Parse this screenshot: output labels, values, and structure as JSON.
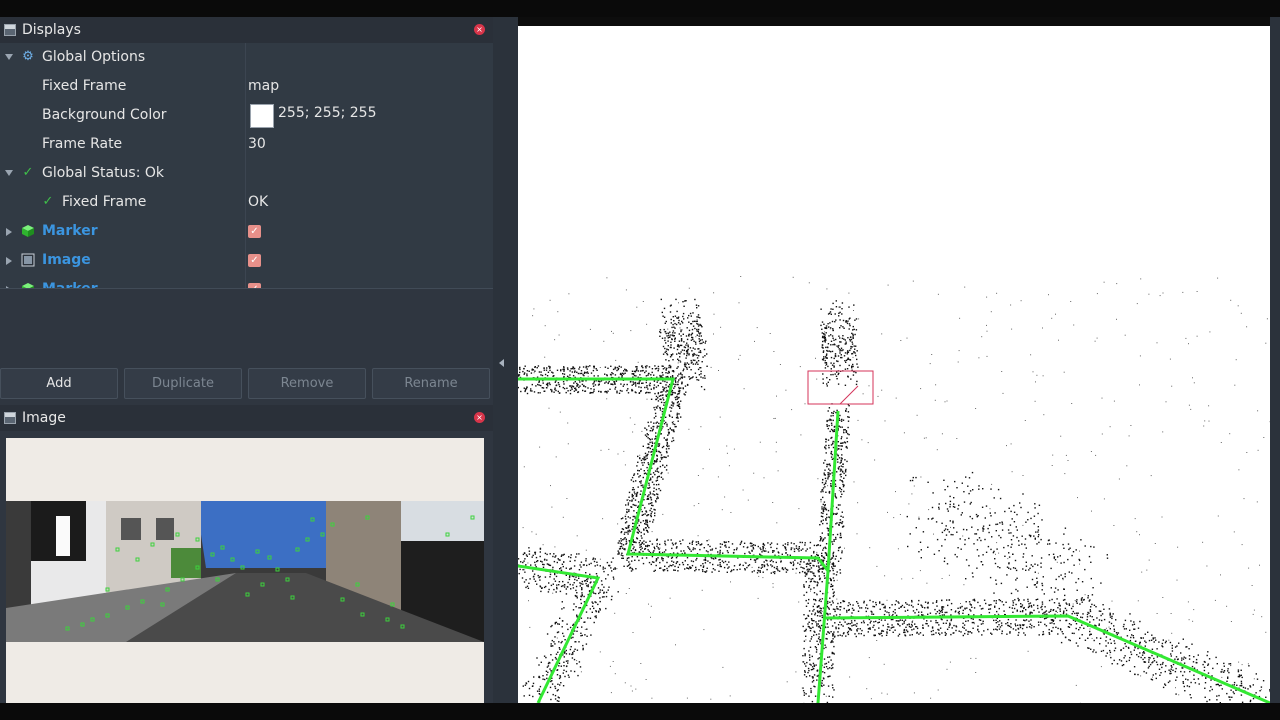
{
  "displays_panel": {
    "title": "Displays",
    "rows": [
      {
        "label": "Global Options",
        "value": ""
      },
      {
        "label": "Fixed Frame",
        "value": "map"
      },
      {
        "label": "Background Color",
        "value": "255; 255; 255"
      },
      {
        "label": "Frame Rate",
        "value": "30"
      },
      {
        "label": "Global Status: Ok",
        "value": ""
      },
      {
        "label": "Fixed Frame",
        "value": "OK"
      },
      {
        "label": "Marker",
        "value": ""
      },
      {
        "label": "Image",
        "value": ""
      },
      {
        "label": "Marker",
        "value": ""
      }
    ],
    "icons": {
      "global_options": "gear-icon",
      "status_ok": "check-icon",
      "marker": "green-cube-icon",
      "image": "image-icon"
    },
    "background_color_swatch": "#ffffff",
    "marker_checked": true,
    "image_checked": true
  },
  "buttons": {
    "add": "Add",
    "duplicate": "Duplicate",
    "remove": "Remove",
    "rename": "Rename"
  },
  "image_panel": {
    "title": "Image"
  },
  "colors": {
    "panel_bg": "#2f3640",
    "accent_blue": "#3b95e0",
    "trajectory_green": "#33e833",
    "camera_frustum": "#d4335a"
  }
}
